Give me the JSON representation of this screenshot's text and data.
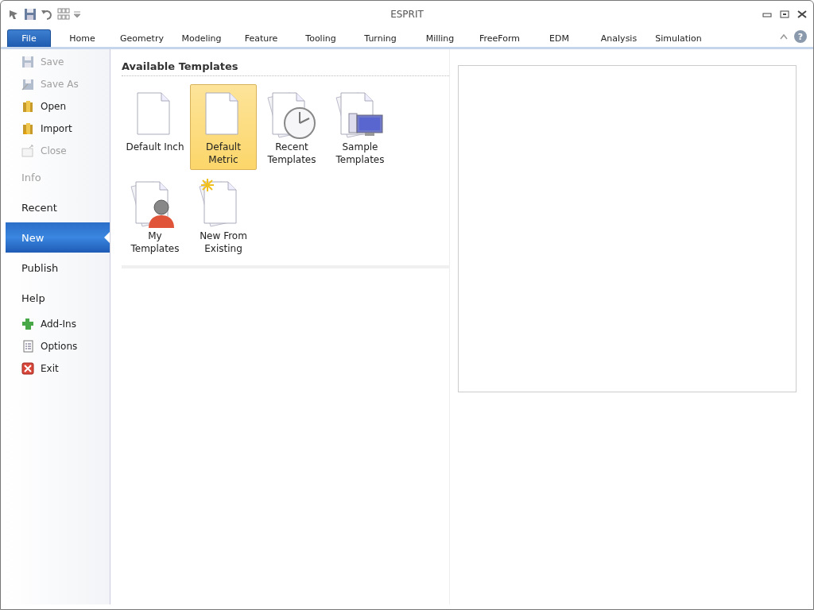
{
  "window": {
    "title": "ESPRIT"
  },
  "tabs": [
    {
      "label": "File",
      "selected": true
    },
    {
      "label": "Home",
      "selected": false
    },
    {
      "label": "Geometry",
      "selected": false
    },
    {
      "label": "Modeling",
      "selected": false
    },
    {
      "label": "Feature",
      "selected": false
    },
    {
      "label": "Tooling",
      "selected": false
    },
    {
      "label": "Turning",
      "selected": false
    },
    {
      "label": "Milling",
      "selected": false
    },
    {
      "label": "FreeForm",
      "selected": false
    },
    {
      "label": "EDM",
      "selected": false
    },
    {
      "label": "Analysis",
      "selected": false
    },
    {
      "label": "Simulation",
      "selected": false
    }
  ],
  "help_button": {
    "label": "?"
  },
  "sidebar": {
    "items": [
      {
        "kind": "command",
        "label": "Save",
        "disabled": true,
        "selected": false
      },
      {
        "kind": "command",
        "label": "Save As",
        "disabled": true,
        "selected": false
      },
      {
        "kind": "command",
        "label": "Open",
        "disabled": false,
        "selected": false
      },
      {
        "kind": "command",
        "label": "Import",
        "disabled": false,
        "selected": false
      },
      {
        "kind": "command",
        "label": "Close",
        "disabled": true,
        "selected": false
      },
      {
        "kind": "section",
        "label": "Info",
        "disabled": true,
        "selected": false
      },
      {
        "kind": "section",
        "label": "Recent",
        "disabled": false,
        "selected": false
      },
      {
        "kind": "section",
        "label": "New",
        "disabled": false,
        "selected": true
      },
      {
        "kind": "section",
        "label": "Publish",
        "disabled": false,
        "selected": false
      },
      {
        "kind": "section",
        "label": "Help",
        "disabled": false,
        "selected": false
      },
      {
        "kind": "command",
        "label": "Add-Ins",
        "disabled": false,
        "selected": false
      },
      {
        "kind": "command",
        "label": "Options",
        "disabled": false,
        "selected": false
      },
      {
        "kind": "command",
        "label": "Exit",
        "disabled": false,
        "selected": false
      }
    ]
  },
  "templates": {
    "heading": "Available Templates",
    "items": [
      {
        "lines": [
          "Default Inch"
        ],
        "selected": false
      },
      {
        "lines": [
          "Default",
          "Metric"
        ],
        "selected": true
      },
      {
        "lines": [
          "Recent",
          "Templates"
        ],
        "selected": false
      },
      {
        "lines": [
          "Sample",
          "Templates"
        ],
        "selected": false
      },
      {
        "lines": [
          "My",
          "Templates"
        ],
        "selected": false
      },
      {
        "lines": [
          "New From",
          "Existing"
        ],
        "selected": false
      }
    ]
  }
}
